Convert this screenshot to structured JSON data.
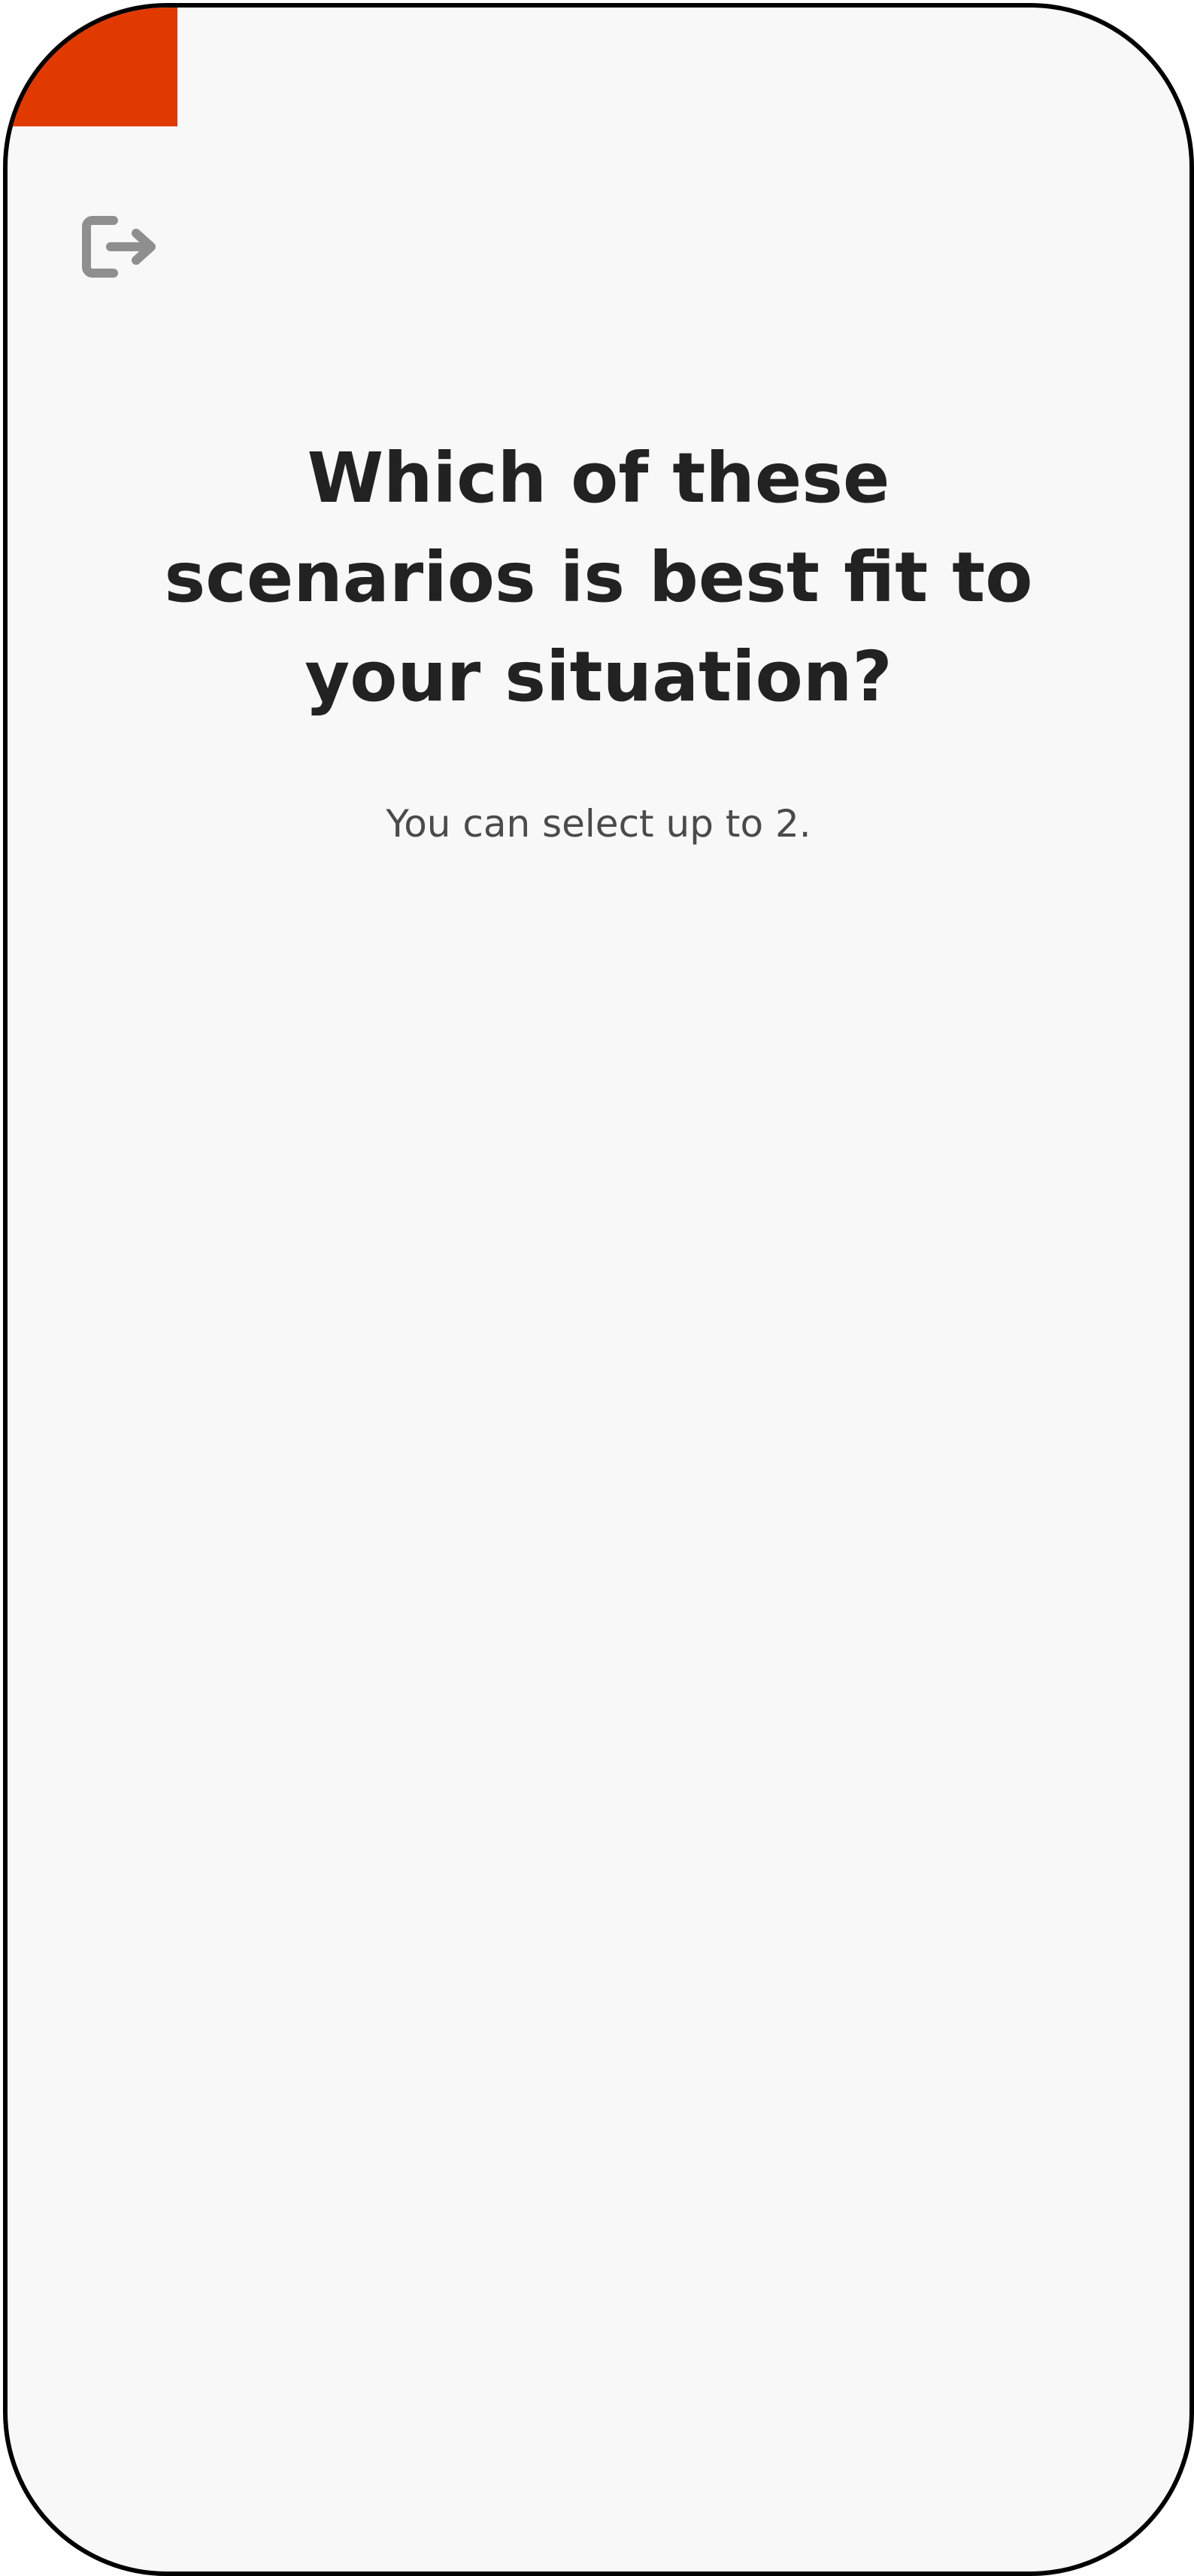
{
  "theme": {
    "accent_color": "#e03a00",
    "background_color": "#f8f8f8",
    "frame_color": "#000000",
    "title_color": "#222222",
    "subtitle_color": "#4a4a4a",
    "icon_color": "#8f8f8f"
  },
  "header": {
    "exit_icon": "exit-icon"
  },
  "question": {
    "title": "Which of these scenarios is best fit to your situation?",
    "subtitle": "You can select up to 2."
  }
}
